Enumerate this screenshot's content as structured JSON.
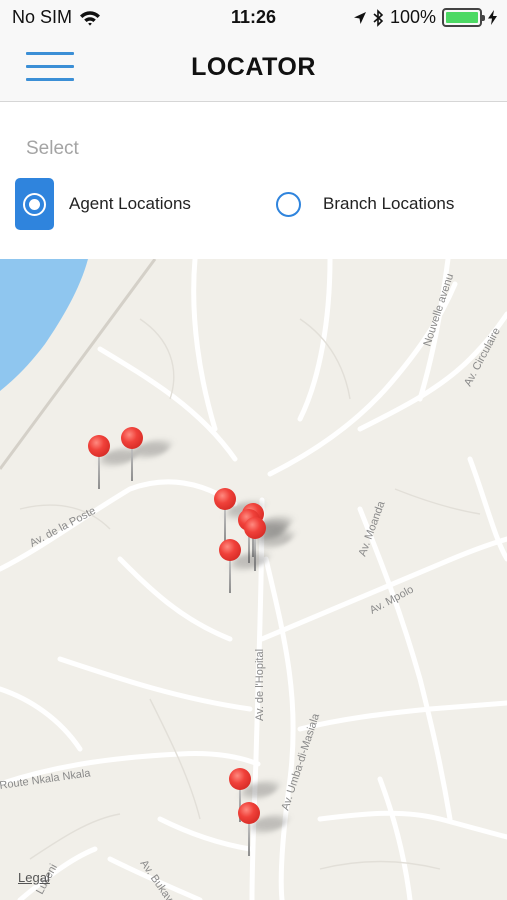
{
  "status_bar": {
    "carrier": "No SIM",
    "time": "11:26",
    "battery": "100%",
    "battery_level": 1.0,
    "icons": [
      "wifi-icon",
      "location-arrow-icon",
      "bluetooth-icon",
      "battery-icon",
      "charging-bolt-icon"
    ]
  },
  "nav": {
    "title": "LOCATOR",
    "menu_icon": "hamburger-menu-icon"
  },
  "selector": {
    "label": "Select",
    "options": [
      {
        "label": "Agent Locations",
        "selected": true
      },
      {
        "label": "Branch Locations",
        "selected": false
      }
    ]
  },
  "map": {
    "streets": [
      "Av. de la Poste",
      "Nouvelle avenu",
      "Av. Circulaire",
      "Av. Moanda",
      "Av. Mpolo",
      "Av. de l'Hopital",
      "Av. Umba-di-Masiala",
      "Route Nkala Nkala",
      "Av. Bukavu",
      "Lukeni"
    ],
    "legal_link": "Legal",
    "pin_count": 9,
    "colors": {
      "accent": "#2f84dd",
      "pin": "#e53935",
      "water": "#8fc6ef",
      "land": "#f1efe9",
      "road": "#ffffff"
    }
  }
}
